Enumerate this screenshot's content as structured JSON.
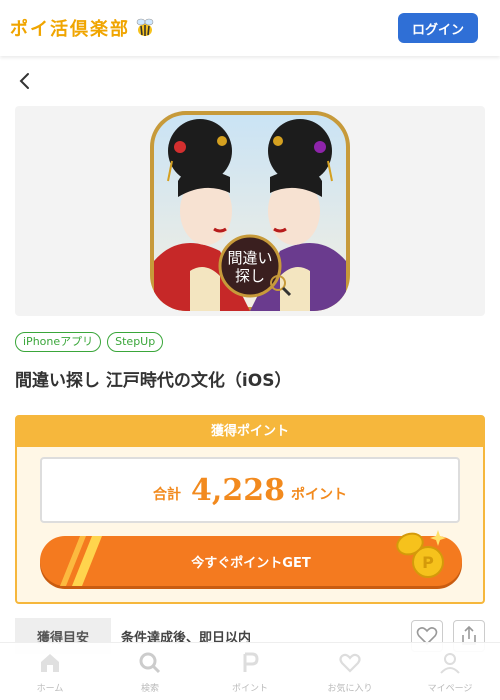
{
  "header": {
    "logo_text": "ポイ活倶楽部",
    "login_label": "ログイン"
  },
  "icons": {
    "back": "chevron-left-icon",
    "logo": "bee-icon",
    "favorite": "heart-outline-icon",
    "share": "share-icon"
  },
  "app": {
    "icon_text": "間違い探し"
  },
  "tags": [
    "iPhoneアプリ",
    "StepUp"
  ],
  "title": "間違い探し 江戸時代の文化（iOS）",
  "points": {
    "header": "獲得ポイント",
    "total_label": "合計",
    "total_value": "4,228",
    "unit": "ポイント",
    "cta": "今すぐポイントGET"
  },
  "estimate": {
    "label": "獲得目安",
    "text": "条件達成後、即日以内"
  },
  "tabbar": [
    {
      "label": "ホーム",
      "icon": "home-icon"
    },
    {
      "label": "検索",
      "icon": "search-icon"
    },
    {
      "label": "ポイント",
      "icon": "point-icon"
    },
    {
      "label": "お気に入り",
      "icon": "heart-icon"
    },
    {
      "label": "マイページ",
      "icon": "user-icon"
    }
  ],
  "colors": {
    "accent": "#f6b73c",
    "brand": "#2f6fd6",
    "cta": "#f47a1f",
    "tag": "#3aa63a"
  }
}
